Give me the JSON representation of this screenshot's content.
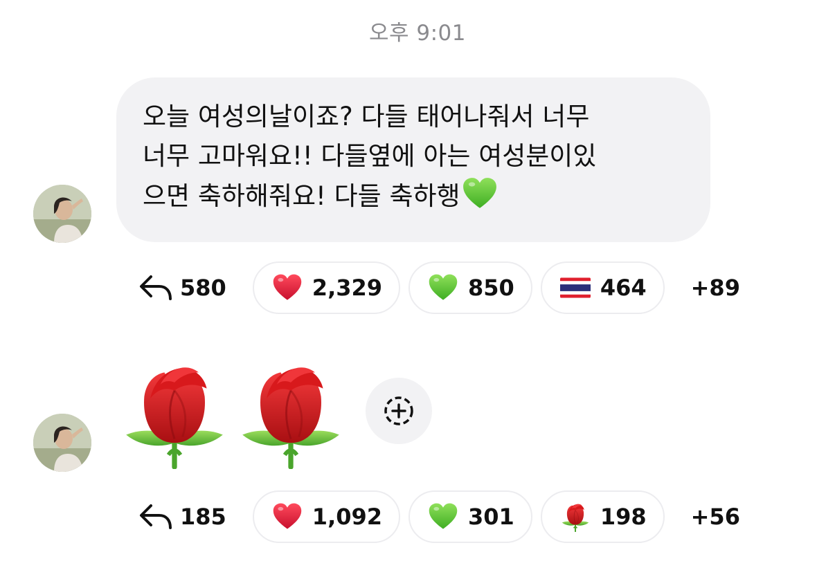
{
  "timestamp": "오후 9:01",
  "message1": {
    "text_lines": [
      "오늘 여성의날이죠? 다들 태어나줘서 너무",
      "너무 고마워요!! 다들옆에 아는 여성분이있",
      "으면 축하해줘요! 다들 축하행"
    ],
    "trailing_emoji": "green-heart-icon",
    "reactions": {
      "reply_count": "580",
      "pills": [
        {
          "emoji": "red-heart-icon",
          "count": "2,329"
        },
        {
          "emoji": "green-heart-icon",
          "count": "850"
        },
        {
          "emoji": "thailand-flag-icon",
          "count": "464"
        }
      ],
      "more": "+89"
    }
  },
  "message2": {
    "emojis": [
      "rose-icon",
      "rose-icon"
    ],
    "reactions": {
      "reply_count": "185",
      "pills": [
        {
          "emoji": "red-heart-icon",
          "count": "1,092"
        },
        {
          "emoji": "green-heart-icon",
          "count": "301"
        },
        {
          "emoji": "rose-icon",
          "count": "198"
        }
      ],
      "more": "+56"
    }
  },
  "colors": {
    "bubble_bg": "#f2f2f4",
    "timestamp": "#8a8a8e",
    "pill_border": "#ececef",
    "red_heart": "#e8263b",
    "green_heart": "#5fc83a"
  }
}
